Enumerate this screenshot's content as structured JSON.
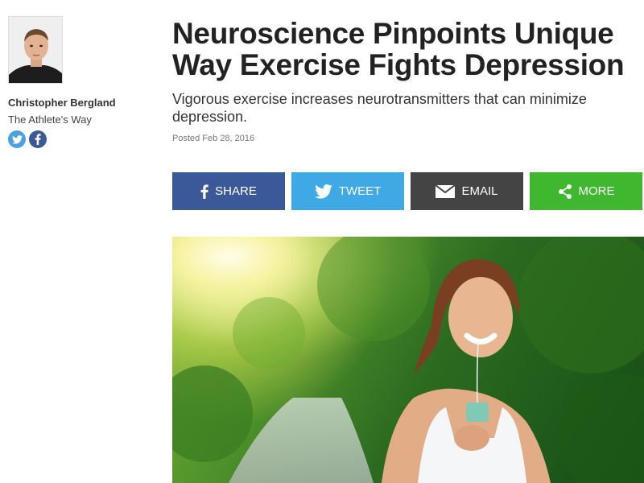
{
  "author": {
    "name": "Christopher Bergland",
    "blog": "The Athlete's Way"
  },
  "social_mini": {
    "twitter_icon": "twitter-icon",
    "facebook_icon": "facebook-icon"
  },
  "article": {
    "title": "Neuroscience Pinpoints Unique Way Exercise Fights Depression",
    "subtitle": "Vigorous exercise increases neurotransmitters that can minimize depression.",
    "posted": "Posted Feb 28, 2016"
  },
  "share": {
    "facebook": "SHARE",
    "twitter": "TWEET",
    "email": "EMAIL",
    "more": "MORE"
  },
  "colors": {
    "facebook": "#3b5998",
    "twitter": "#3fa9e6",
    "email": "#444444",
    "more": "#3fb82f"
  }
}
